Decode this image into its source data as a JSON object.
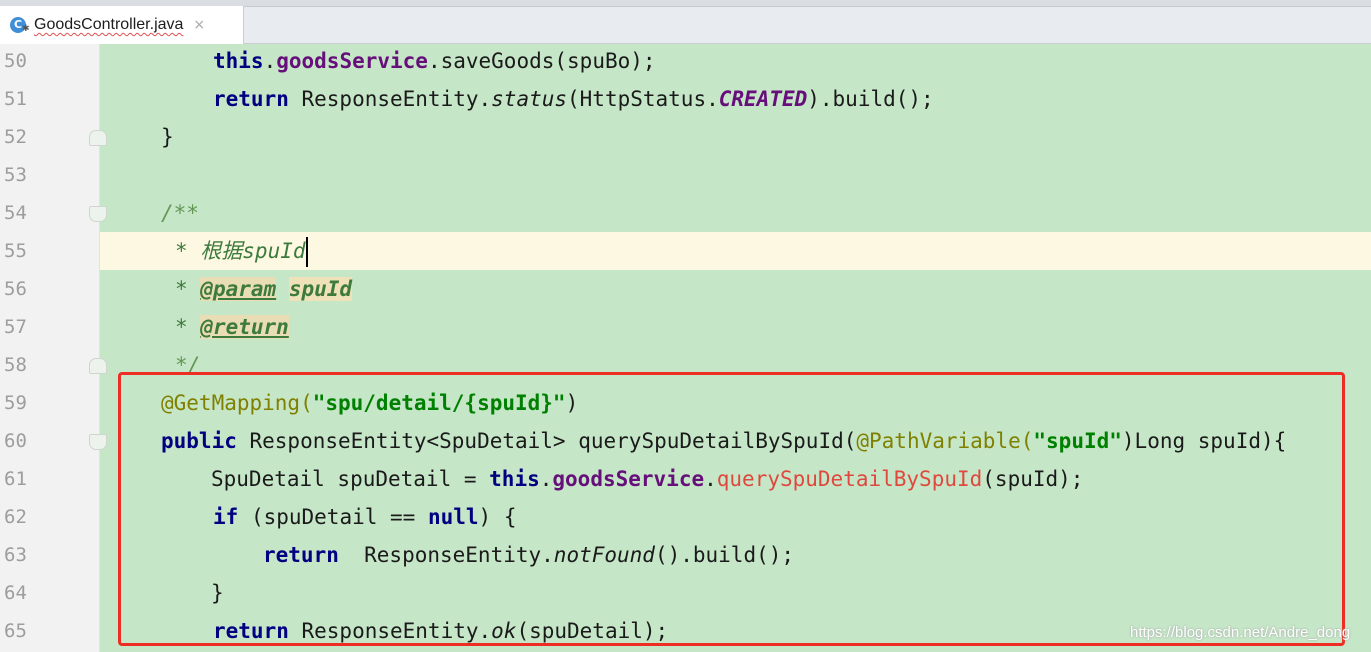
{
  "tab": {
    "filename": "GoodsController.java",
    "file_icon": "C",
    "close": "×"
  },
  "lines": [
    {
      "n": "50",
      "parts": [
        {
          "t": "this",
          "c": "kw"
        },
        {
          "t": "."
        },
        {
          "t": "goodsService",
          "c": "fld"
        },
        {
          "t": ".saveGoods(spuBo);"
        }
      ]
    },
    {
      "n": "51",
      "parts": [
        {
          "t": "return",
          "c": "kw"
        },
        {
          "t": " ResponseEntity."
        },
        {
          "t": "status",
          "c": "ital"
        },
        {
          "t": "(HttpStatus."
        },
        {
          "t": "CREATED",
          "c": "const"
        },
        {
          "t": ").build();"
        }
      ]
    },
    {
      "n": "52",
      "parts": [
        {
          "t": "}"
        }
      ]
    },
    {
      "n": "53",
      "parts": []
    },
    {
      "n": "54",
      "parts": [
        {
          "t": "/**",
          "c": "cmt"
        }
      ]
    },
    {
      "n": "55",
      "parts": [
        {
          "t": "* 根据spuId",
          "c": "cmtdark"
        }
      ]
    },
    {
      "n": "56",
      "parts": [
        {
          "t": "* ",
          "c": "cmtdark"
        },
        {
          "t": "@param",
          "c": "tag"
        },
        {
          "t": " "
        },
        {
          "t": "spuId",
          "c": "tagval"
        }
      ]
    },
    {
      "n": "57",
      "parts": [
        {
          "t": "* ",
          "c": "cmtdark"
        },
        {
          "t": "@return",
          "c": "tag"
        }
      ]
    },
    {
      "n": "58",
      "parts": [
        {
          "t": "*/",
          "c": "cmt"
        }
      ]
    },
    {
      "n": "59",
      "parts": [
        {
          "t": "@GetMapping(",
          "c": "ann"
        },
        {
          "t": "\"spu/detail/{spuId}\"",
          "c": "str"
        },
        {
          "t": ")"
        }
      ]
    },
    {
      "n": "60",
      "parts": [
        {
          "t": "public",
          "c": "kw"
        },
        {
          "t": " ResponseEntity<SpuDetail> querySpuDetailBySpuId("
        },
        {
          "t": "@PathVariable(",
          "c": "ann"
        },
        {
          "t": "\"spuId\"",
          "c": "str"
        },
        {
          "t": ")Long spuId){"
        }
      ]
    },
    {
      "n": "61",
      "parts": [
        {
          "t": "SpuDetail spuDetail = "
        },
        {
          "t": "this",
          "c": "kw"
        },
        {
          "t": "."
        },
        {
          "t": "goodsService",
          "c": "fld"
        },
        {
          "t": "."
        },
        {
          "t": "querySpuDetailBySpuId",
          "c": "err"
        },
        {
          "t": "(spuId);"
        }
      ]
    },
    {
      "n": "62",
      "parts": [
        {
          "t": "if",
          "c": "kw"
        },
        {
          "t": " (spuDetail == "
        },
        {
          "t": "null",
          "c": "kw"
        },
        {
          "t": ") {"
        }
      ]
    },
    {
      "n": "63",
      "parts": [
        {
          "t": "return",
          "c": "kw"
        },
        {
          "t": "  ResponseEntity."
        },
        {
          "t": "notFound",
          "c": "ital"
        },
        {
          "t": "().build();"
        }
      ]
    },
    {
      "n": "64",
      "parts": [
        {
          "t": "}"
        }
      ]
    },
    {
      "n": "65",
      "parts": [
        {
          "t": "return",
          "c": "kw"
        },
        {
          "t": " ResponseEntity."
        },
        {
          "t": "ok",
          "c": "ital"
        },
        {
          "t": "(spuDetail);"
        }
      ]
    }
  ],
  "watermark": "https://blog.csdn.net/Andre_dong",
  "colors": {
    "editor_bg": "#c6e6c8",
    "current_line_bg": "#fdf8e2",
    "highlight_box": "#ee2e24",
    "keyword": "#000080",
    "string": "#008000",
    "annotation": "#808000",
    "error_method": "#e0483e"
  },
  "current_line": "55"
}
